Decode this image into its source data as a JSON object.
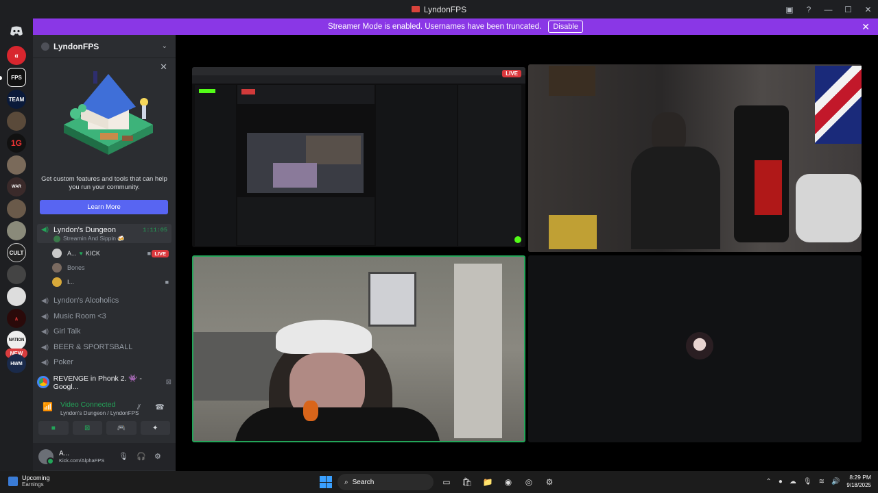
{
  "window": {
    "title": "LyndonFPS"
  },
  "banner": {
    "message": "Streamer Mode is enabled. Usernames have been truncated.",
    "disable_label": "Disable"
  },
  "rail": {
    "servers": [
      "discord-home",
      "alpha",
      "fps",
      "team",
      "avatar",
      "1g",
      "avatar",
      "war-of-the-worlds",
      "avatar",
      "avatar",
      "cult",
      "avatar",
      "avatar",
      "avatar",
      "nation",
      "hwm"
    ],
    "new_badge": "NEW"
  },
  "server": {
    "name": "LyndonFPS"
  },
  "promo": {
    "text": "Get custom features and tools that can help you run your community.",
    "learn_more": "Learn More"
  },
  "channels": {
    "active": {
      "name": "Lyndon's Dungeon",
      "timer": "1:11:05",
      "status": "Streamin And Sippin 🍻"
    },
    "users": [
      {
        "name": "A...",
        "tag": "KICK",
        "live": "LIVE"
      },
      {
        "name": "Bones"
      },
      {
        "name": "I..."
      }
    ],
    "others": [
      "Lyndon's Alcoholics",
      "Music Room <3",
      "Girl Talk",
      "BEER & SPORTSBALL",
      "Poker"
    ]
  },
  "now_playing": {
    "title": "REVENGE in Phonk 2. 👾 - Googl..."
  },
  "voice": {
    "status": "Video Connected",
    "location": "Lyndon's Dungeon / LyndonFPS"
  },
  "user_bar": {
    "name": "A...",
    "status": "Kick.com/AlphaFPS"
  },
  "stage": {
    "live_label": "LIVE"
  },
  "taskbar": {
    "weather_title": "Upcoming",
    "weather_sub": "Earnings",
    "search": "Search",
    "time": "8:29 PM",
    "date": "9/18/2025"
  },
  "colors": {
    "accent": "#5865f2",
    "banner": "#8a37e6",
    "online": "#23a559",
    "live": "#da373c"
  }
}
